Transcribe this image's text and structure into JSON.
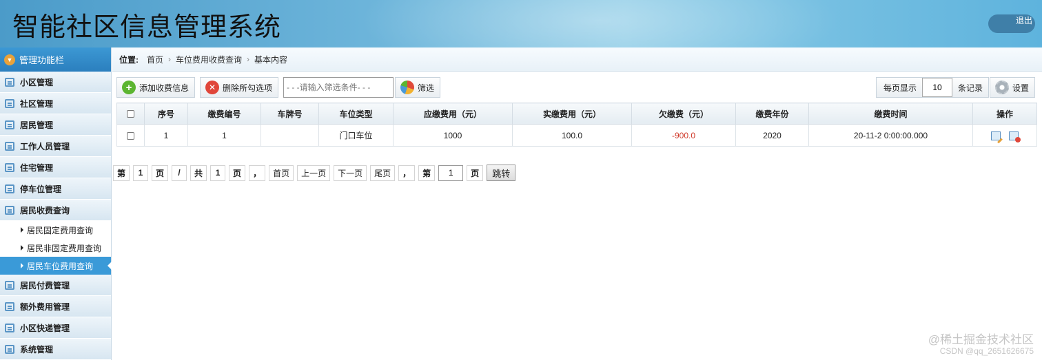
{
  "header": {
    "title": "智能社区信息管理系统",
    "logout_label": "退出"
  },
  "sidebar": {
    "heading": "管理功能栏",
    "items": [
      {
        "label": "小区管理"
      },
      {
        "label": "社区管理"
      },
      {
        "label": "居民管理"
      },
      {
        "label": "工作人员管理"
      },
      {
        "label": "住宅管理"
      },
      {
        "label": "停车位管理"
      },
      {
        "label": "居民收费查询"
      }
    ],
    "subitems": [
      {
        "label": "居民固定费用查询"
      },
      {
        "label": "居民非固定费用查询"
      },
      {
        "label": "居民车位费用查询",
        "active": true
      }
    ],
    "items_after": [
      {
        "label": "居民付费管理"
      },
      {
        "label": "额外费用管理"
      },
      {
        "label": "小区快递管理"
      },
      {
        "label": "系统管理"
      }
    ]
  },
  "breadcrumb": {
    "label": "位置:",
    "items": [
      "首页",
      "车位费用收费查询",
      "基本内容"
    ]
  },
  "toolbar": {
    "add_label": "添加收费信息",
    "delete_label": "删除所勾选项",
    "filter_placeholder": "- - -请输入筛选条件- - -",
    "filter_label": "筛选",
    "perpage_label": "每页显示",
    "perpage_value": "10",
    "perpage_unit": "条记录",
    "settings_label": "设置"
  },
  "table": {
    "columns": [
      "序号",
      "缴费编号",
      "车牌号",
      "车位类型",
      "应缴费用（元）",
      "实缴费用（元）",
      "欠缴费（元）",
      "缴费年份",
      "缴费时间",
      "操作"
    ],
    "rows": [
      {
        "index": "1",
        "code": "1",
        "plate": "",
        "type": "门口车位",
        "due": "1000",
        "paid": "100.0",
        "owed": "-900.0",
        "year": "2020",
        "time": "20-11-2 0:00:00.000"
      }
    ]
  },
  "pager": {
    "page_prefix": "第",
    "current": "1",
    "page_suffix": "页",
    "slash": "/",
    "total_prefix": "共",
    "total": "1",
    "total_suffix": "页",
    "comma": "，",
    "first": "首页",
    "prev": "上一页",
    "next": "下一页",
    "last": "尾页",
    "comma2": "，",
    "goto_prefix": "第",
    "goto_value": "1",
    "goto_suffix": "页",
    "go": "跳转"
  },
  "watermark": {
    "line1": "@稀土掘金技术社区",
    "line2": "CSDN @qq_2651626675"
  }
}
